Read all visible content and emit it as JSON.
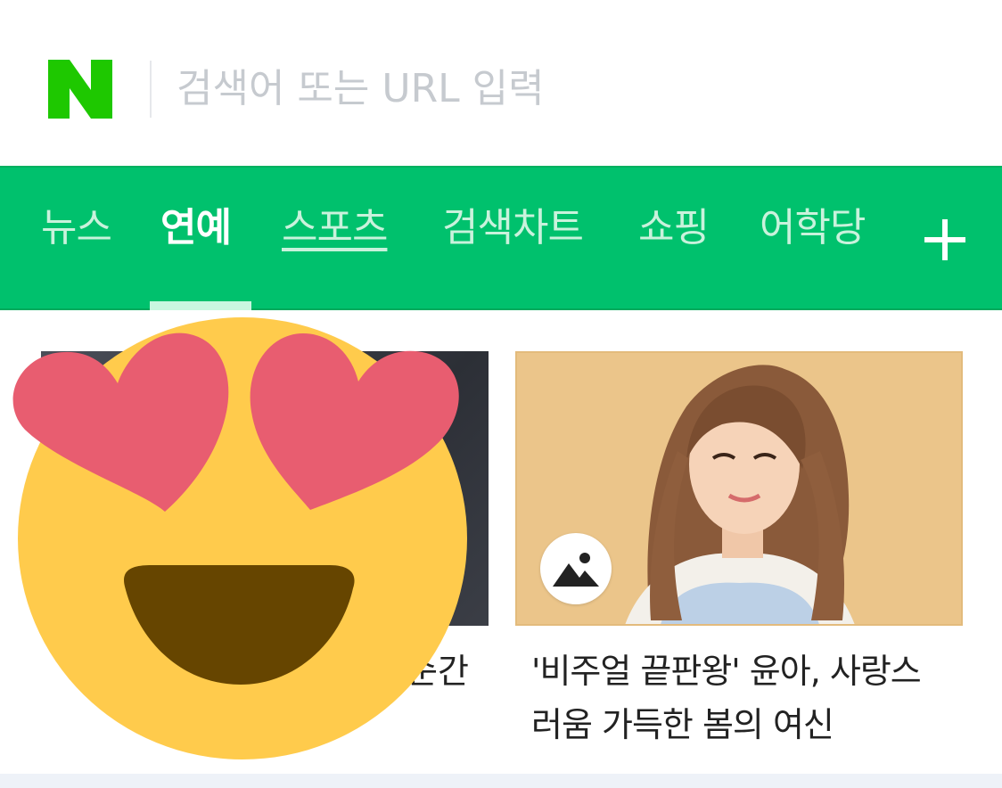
{
  "header": {
    "logo_letter": "N",
    "search_placeholder": "검색어 또는 URL 입력"
  },
  "nav": {
    "items": [
      {
        "label": "뉴스",
        "active": false
      },
      {
        "label": "연예",
        "active": true
      },
      {
        "label": "스포츠",
        "active": false
      },
      {
        "label": "검색차트",
        "active": false
      },
      {
        "label": "쇼핑",
        "active": false
      },
      {
        "label": "어학당",
        "active": false
      }
    ],
    "more_icon": "plus-icon"
  },
  "content": {
    "left_card": {
      "title_visible": "순간"
    },
    "right_card": {
      "title_line1": "'비주얼 끝판왕' 윤아, 사랑스",
      "title_line2": "러움 가득한 봄의 여신",
      "badge_icon": "photo-gallery-icon"
    }
  },
  "overlay": {
    "emoji": "heart-eyes-emoji-icon"
  },
  "colors": {
    "brand_green": "#00c16d",
    "nav_text_inactive": "#c9f2dc",
    "nav_text_active": "#ffffff",
    "emoji_face": "#ffcb4c",
    "emoji_hearts": "#e85d70",
    "emoji_mouth": "#664500"
  }
}
